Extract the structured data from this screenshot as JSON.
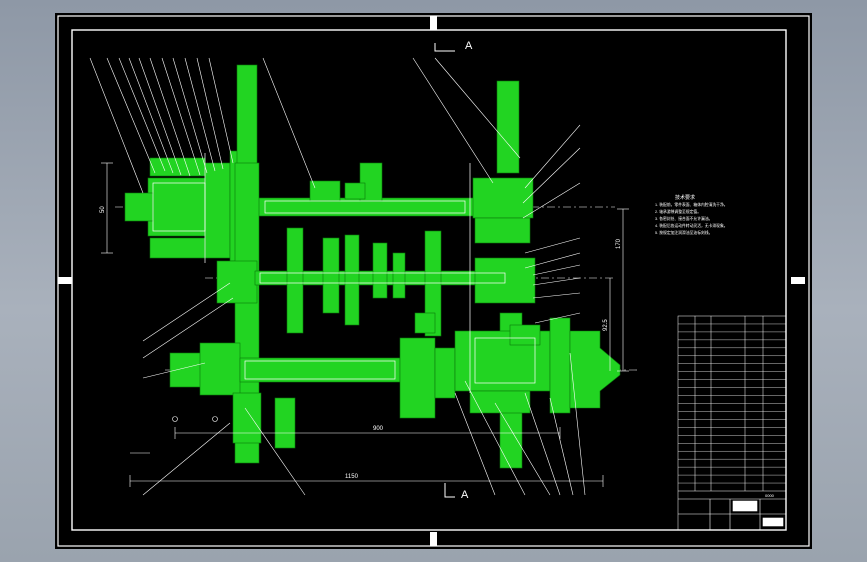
{
  "drawing": {
    "section_marker": "A",
    "dimensions": {
      "overall_length": "1150",
      "inner_length": "900",
      "height_total": "170",
      "height_sub": "92.5",
      "left_dim": "50"
    },
    "notes_title": "技术要求",
    "notes": [
      "1. 装配前，零件表面、箱体内腔清洗干净。",
      "2. 轴承游隙调整至规定值。",
      "3. 各密封处、接合面不允许漏油。",
      "4. 装配后各运动件转动灵活，无卡滞现象。",
      "5. 按规定加注润滑油至油标刻线。"
    ],
    "title_block": {
      "rows": 22,
      "drawing_no": "0000"
    }
  },
  "colors": {
    "background": "#000000",
    "part_fill": "#22d422",
    "line": "#ffffff",
    "frame": "#ffffff"
  }
}
